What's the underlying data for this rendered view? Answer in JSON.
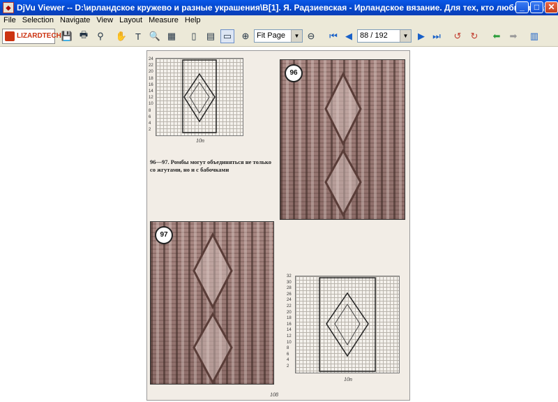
{
  "window": {
    "title": "DjVu Viewer -- D:\\ирландское кружево и разные украшения\\В[1]. Я. Радзиевская - Ирландское вязание. Для тех, кто любит вязать.djvu",
    "app_icon": "djvu-app-icon"
  },
  "controls": {
    "minimize": "_",
    "maximize": "□",
    "close": "✕"
  },
  "menu": [
    "File",
    "Selection",
    "Navigate",
    "View",
    "Layout",
    "Measure",
    "Help"
  ],
  "toolbar": {
    "logo_label": "LIZARDTECH",
    "zoom_value": "Fit Page",
    "page_value": "88 / 192",
    "zoom_in_glyph": "⊕",
    "zoom_out_glyph": "⊖"
  },
  "page": {
    "caption": "96—97. Ромбы могут объединяться не только со жгутами, но и с бабочками",
    "badge_96": "96",
    "badge_97": "97",
    "chart_top_width": "10п",
    "chart_bottom_width": "10п",
    "page_number": "108",
    "top_chart_rows": [
      "24",
      "22",
      "20",
      "18",
      "16",
      "14",
      "12",
      "10",
      "8",
      "6",
      "4",
      "2"
    ],
    "bottom_chart_rows": [
      "32",
      "30",
      "28",
      "26",
      "24",
      "22",
      "20",
      "18",
      "16",
      "14",
      "12",
      "10",
      "8",
      "6",
      "4",
      "2"
    ]
  },
  "colors": {
    "titlebar": "#0a58e8",
    "chrome": "#ece9d8",
    "knit": "#a88782"
  }
}
